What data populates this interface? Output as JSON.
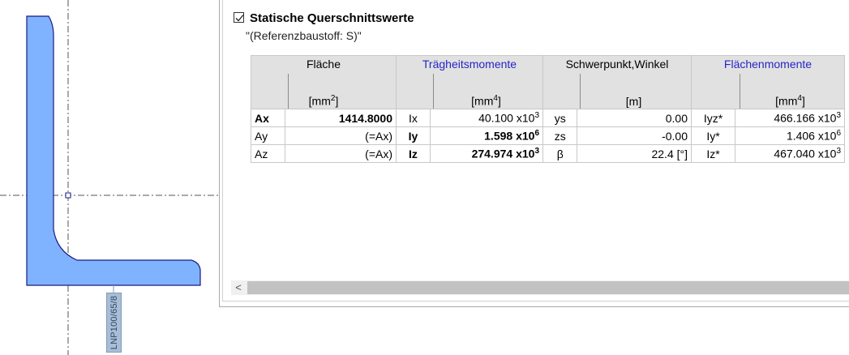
{
  "section": {
    "title": "Statische Querschnittswerte",
    "checked": true,
    "subtitle": "\"(Referenzbaustoff: S)\""
  },
  "profile": {
    "label": "LNP100/65/8",
    "fill_color": "#7fb3ff",
    "stroke_color": "#1a1a80"
  },
  "table": {
    "groups": [
      {
        "title": "Fläche",
        "unit": "[mm",
        "sup": "2",
        "unit_end": "]",
        "color": "#000000"
      },
      {
        "title": "Trägheitsmomente",
        "unit": "[mm",
        "sup": "4",
        "unit_end": "]",
        "color": "#2525c8"
      },
      {
        "title": "Schwerpunkt,Winkel",
        "unit": "[m]",
        "sup": "",
        "unit_end": "",
        "color": "#000000"
      },
      {
        "title": "Flächenmomente",
        "unit": "[mm",
        "sup": "4",
        "unit_end": "]",
        "color": "#2525c8"
      }
    ],
    "rows": [
      {
        "a_label": "Ax",
        "a_value": "1414.8000",
        "i_label": "Ix",
        "i_value": "40.100 x10",
        "i_exp": "3",
        "s_label": "ys",
        "s_value": "0.00",
        "f_label": "Iyz*",
        "f_value": "466.166 x10",
        "f_exp": "3"
      },
      {
        "a_label": "Ay",
        "a_value": "(=Ax)",
        "i_label": "Iy",
        "i_value": "1.598 x10",
        "i_exp": "6",
        "s_label": "zs",
        "s_value": "-0.00",
        "f_label": "Iy*",
        "f_value": "1.406 x10",
        "f_exp": "6"
      },
      {
        "a_label": "Az",
        "a_value": "(=Ax)",
        "i_label": "Iz",
        "i_value": "274.974 x10",
        "i_exp": "3",
        "s_label": "β",
        "s_value": "22.4  [°]",
        "f_label": "Iz*",
        "f_value": "467.040 x10",
        "f_exp": "3"
      }
    ]
  },
  "scrollbar": {
    "left_arrow": "<"
  }
}
